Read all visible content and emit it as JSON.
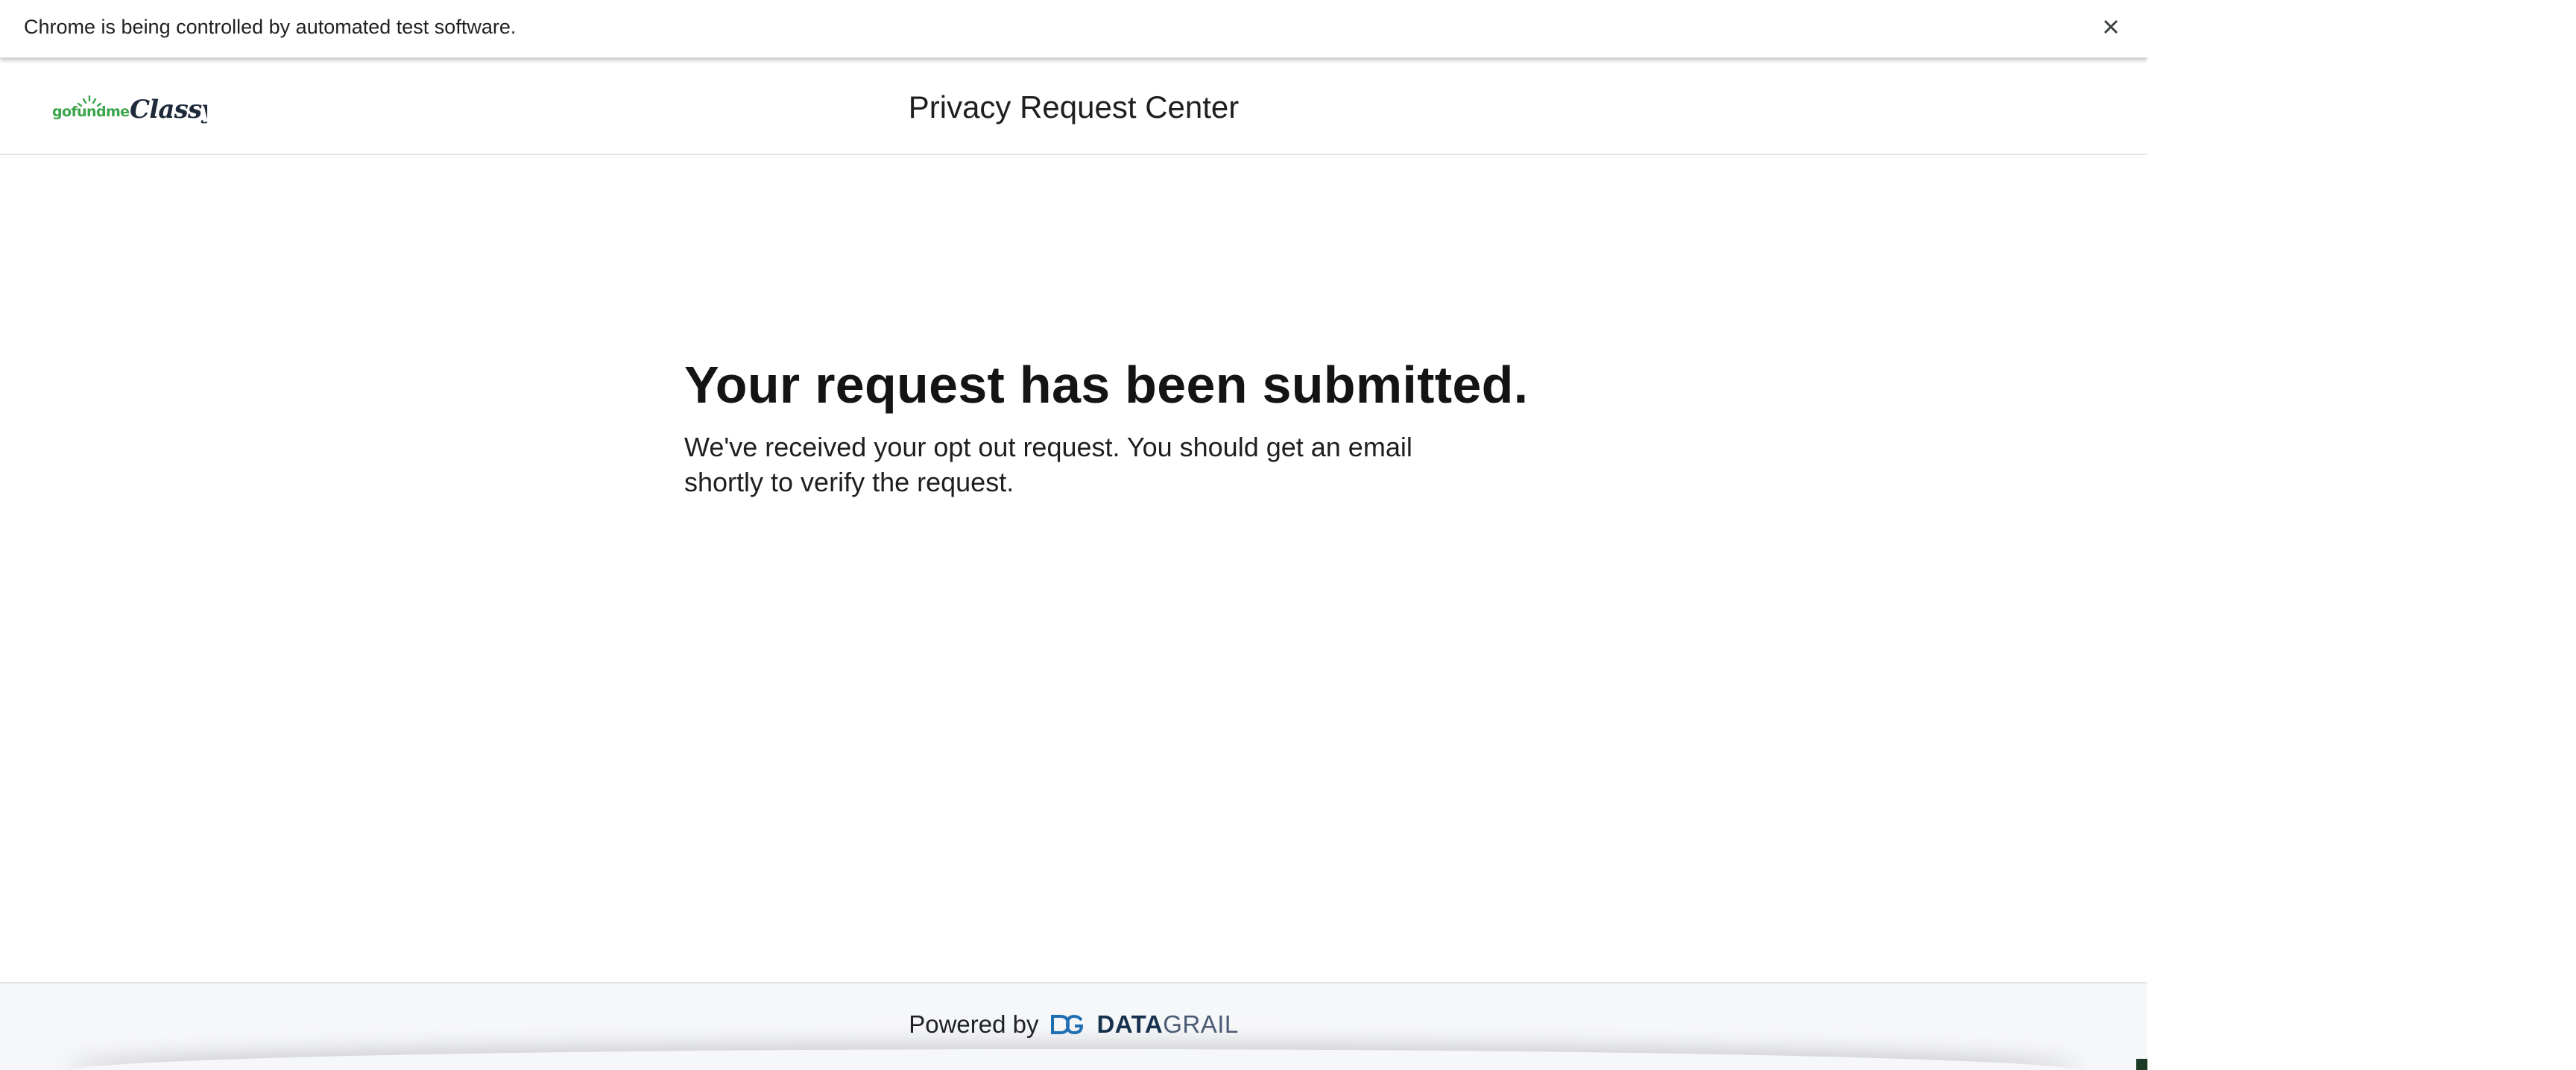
{
  "browser": {
    "infobar_text": "Chrome is being controlled by automated test software.",
    "close_icon": "close-icon"
  },
  "header": {
    "logo_text": "gofundme Classy",
    "title": "Privacy Request Center"
  },
  "main": {
    "headline": "Your request has been submitted.",
    "message": "We've received your opt out request. You should get an email shortly to verify the request."
  },
  "footer": {
    "powered_by": "Powered by",
    "brand_bold": "DATA",
    "brand_light": "GRAIL",
    "brand_icon": "datagrail-logo-icon"
  },
  "colors": {
    "gofundme_green": "#3aa54a",
    "classy_navy": "#1e2a3a",
    "datagrail_blue": "#1f6fb2",
    "datagrail_navy": "#16324f",
    "footer_bg": "#f6f7f9"
  }
}
